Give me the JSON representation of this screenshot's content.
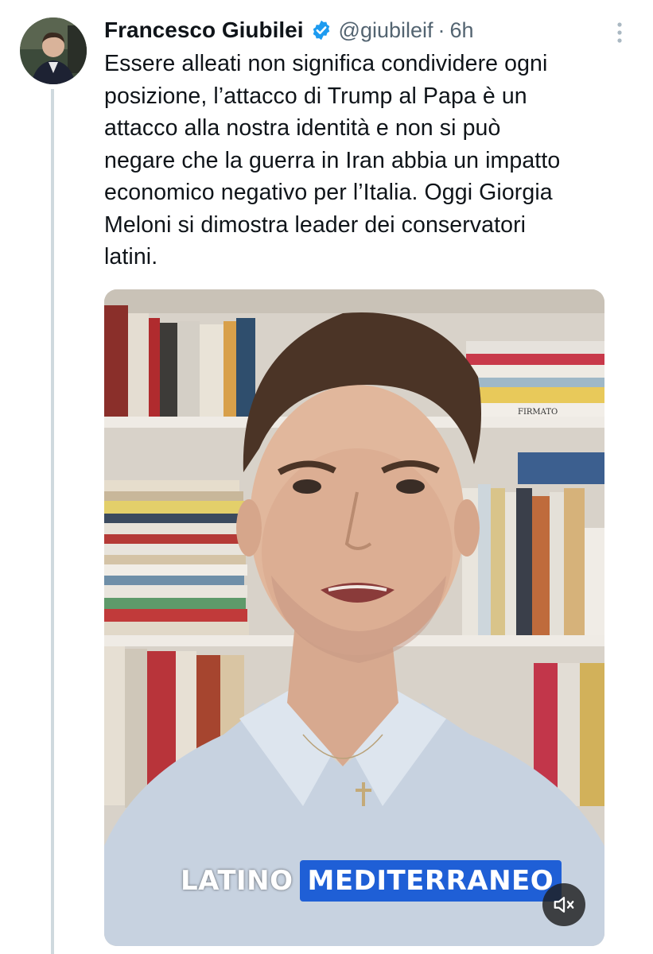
{
  "tweet": {
    "author_name": "Francesco Giubilei",
    "handle": "@giubileif",
    "separator": "·",
    "time": "6h",
    "text": "Essere alleati non significa condividere ogni\nposizione, l’attacco di Trump al Papa è un\nattacco alla nostra identità e non si può\nnegare che la guerra in Iran abbia un impatto\neconomico negativo per l’Italia. Oggi Giorgia\nMeloni si dimostra leader dei conservatori\nlatini."
  },
  "media": {
    "caption_part1": "LATINO",
    "caption_part2": "MEDITERRANEO",
    "book_spine_label": "FIRMATO"
  },
  "icons": {
    "verified": "verified-badge-icon",
    "more": "more-vertical-icon",
    "mute": "speaker-muted-icon"
  },
  "colors": {
    "verified_blue": "#1d9bf0",
    "text_primary": "#0f1419",
    "text_secondary": "#536471",
    "caption_highlight": "#1f5fd6"
  }
}
